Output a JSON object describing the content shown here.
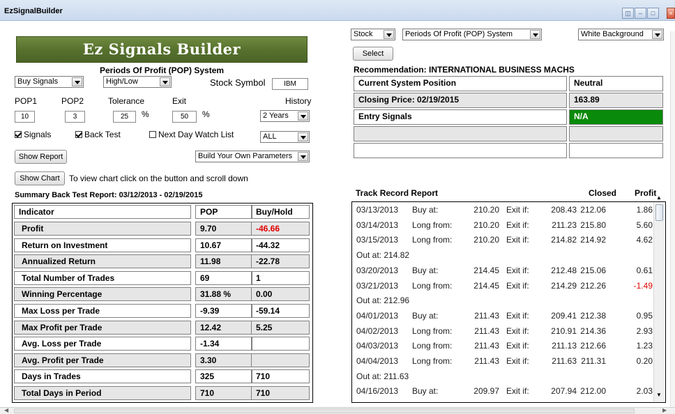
{
  "window": {
    "title": "EzSignalBuilder"
  },
  "banner": "Ez Signals Builder",
  "system_title": "Periods Of Profit (POP) System",
  "controls": {
    "signal_type": "Buy Signals",
    "price_mode": "High/Low",
    "stock_symbol_label": "Stock Symbol",
    "stock_symbol_value": "IBM",
    "pop1_label": "POP1",
    "pop2_label": "POP2",
    "tolerance_label": "Tolerance",
    "exit_label": "Exit",
    "history_label": "History",
    "pop1_value": "10",
    "pop2_value": "3",
    "tolerance_value": "25",
    "exit_value": "50",
    "percent": "%",
    "history_value": "2 Years",
    "signals_label": "Signals",
    "backtest_label": "Back Test",
    "watchlist_label": "Next Day Watch List",
    "filter_value": "ALL",
    "show_report": "Show Report",
    "params_value": "Build Your Own Parameters",
    "show_chart": "Show Chart",
    "chart_hint": "To view chart click on the button and scroll down"
  },
  "summary": {
    "title": "Summary Back Test Report: 03/12/2013  -  02/19/2015",
    "headers": [
      "Indicator",
      "POP",
      "Buy/Hold"
    ],
    "rows": [
      [
        "Profit",
        "9.70",
        "-46.66"
      ],
      [
        "Return on Investment",
        "10.67",
        "-44.32"
      ],
      [
        "Annualized Return",
        "11.98",
        "-22.78"
      ],
      [
        "Total Number of Trades",
        "69",
        "1"
      ],
      [
        "Winning Percentage",
        "31.88 %",
        "0.00"
      ],
      [
        "Max Loss per Trade",
        "-9.39",
        "-59.14"
      ],
      [
        "Max Profit per Trade",
        "12.42",
        "5.25"
      ],
      [
        "Avg. Loss per Trade",
        "-1.34",
        ""
      ],
      [
        "Avg. Profit per Trade",
        "3.30",
        ""
      ],
      [
        "Days in Trades",
        "325",
        "710"
      ],
      [
        "Total Days in Period",
        "710",
        "710"
      ]
    ]
  },
  "top": {
    "market": "Stock",
    "system": "Periods Of Profit (POP) System",
    "background": "White Background",
    "select_btn": "Select"
  },
  "recommendation": {
    "title": "Recommendation: INTERNATIONAL BUSINESS MACHS",
    "rows": [
      [
        "Current System Position",
        "Neutral"
      ],
      [
        "Closing Price: 02/19/2015",
        "163.89"
      ],
      [
        "Entry Signals",
        "N/A"
      ],
      [
        "",
        ""
      ],
      [
        "",
        ""
      ]
    ]
  },
  "track": {
    "title": "Track Record Report",
    "closed_header": "Closed",
    "profit_header": "Profit",
    "rows": [
      {
        "date": "03/13/2013",
        "action": "Buy at:",
        "price": "210.20",
        "exit_lbl": "Exit if:",
        "exit": "208.43",
        "closed": "212.06",
        "profit": "1.86"
      },
      {
        "date": "03/14/2013",
        "action": "Long from:",
        "price": "210.20",
        "exit_lbl": "Exit if:",
        "exit": "211.23",
        "closed": "215.80",
        "profit": "5.60"
      },
      {
        "date": "03/15/2013",
        "action": "Long from:",
        "price": "210.20",
        "exit_lbl": "Exit if:",
        "exit": "214.82",
        "closed": "214.92",
        "profit": "4.62"
      },
      {
        "out": "Out at: 214.82"
      },
      {
        "date": "03/20/2013",
        "action": "Buy at:",
        "price": "214.45",
        "exit_lbl": "Exit if:",
        "exit": "212.48",
        "closed": "215.06",
        "profit": "0.61"
      },
      {
        "date": "03/21/2013",
        "action": "Long from:",
        "price": "214.45",
        "exit_lbl": "Exit if:",
        "exit": "214.29",
        "closed": "212.26",
        "profit": "-1.49"
      },
      {
        "out": "Out at: 212.96"
      },
      {
        "date": "04/01/2013",
        "action": "Buy at:",
        "price": "211.43",
        "exit_lbl": "Exit if:",
        "exit": "209.41",
        "closed": "212.38",
        "profit": "0.95"
      },
      {
        "date": "04/02/2013",
        "action": "Long from:",
        "price": "211.43",
        "exit_lbl": "Exit if:",
        "exit": "210.91",
        "closed": "214.36",
        "profit": "2.93"
      },
      {
        "date": "04/03/2013",
        "action": "Long from:",
        "price": "211.43",
        "exit_lbl": "Exit if:",
        "exit": "211.13",
        "closed": "212.66",
        "profit": "1.23"
      },
      {
        "date": "04/04/2013",
        "action": "Long from:",
        "price": "211.43",
        "exit_lbl": "Exit if:",
        "exit": "211.63",
        "closed": "211.31",
        "profit": "0.20"
      },
      {
        "out": "Out at: 211.63"
      },
      {
        "date": "04/16/2013",
        "action": "Buy at:",
        "price": "209.97",
        "exit_lbl": "Exit if:",
        "exit": "207.94",
        "closed": "212.00",
        "profit": "2.03"
      }
    ]
  }
}
